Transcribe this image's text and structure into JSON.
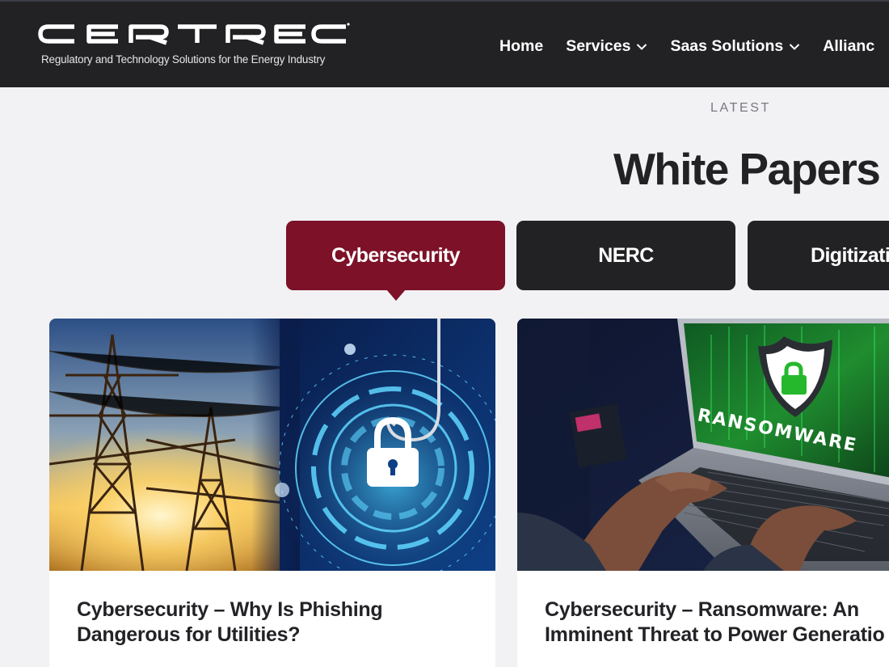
{
  "header": {
    "logo_text": "CERTREC",
    "tagline": "Regulatory and Technology Solutions for the Energy Industry",
    "nav": [
      {
        "label": "Home",
        "has_dropdown": false
      },
      {
        "label": "Services",
        "has_dropdown": true
      },
      {
        "label": "Saas Solutions",
        "has_dropdown": true
      },
      {
        "label": "Allianc",
        "has_dropdown": false
      }
    ]
  },
  "section": {
    "eyebrow": "LATEST",
    "title": "White Papers"
  },
  "tabs": [
    {
      "label": "Cybersecurity",
      "active": true
    },
    {
      "label": "NERC",
      "active": false
    },
    {
      "label": "Digitizatio",
      "active": false
    }
  ],
  "cards": [
    {
      "title_line1": "Cybersecurity – Why Is Phishing",
      "title_line2": "Dangerous for Utilities?",
      "image_icon": "phishing-lock-power-lines-image"
    },
    {
      "title_line1": "Cybersecurity – Ransomware: An",
      "title_line2": "Imminent Threat to Power Generatio",
      "image_text": "RANSOMWARE",
      "image_icon": "ransomware-laptop-image"
    }
  ],
  "colors": {
    "header_bg": "#222224",
    "accent": "#7c1128",
    "tab_inactive": "#222224",
    "page_bg": "#f2f1f4"
  }
}
